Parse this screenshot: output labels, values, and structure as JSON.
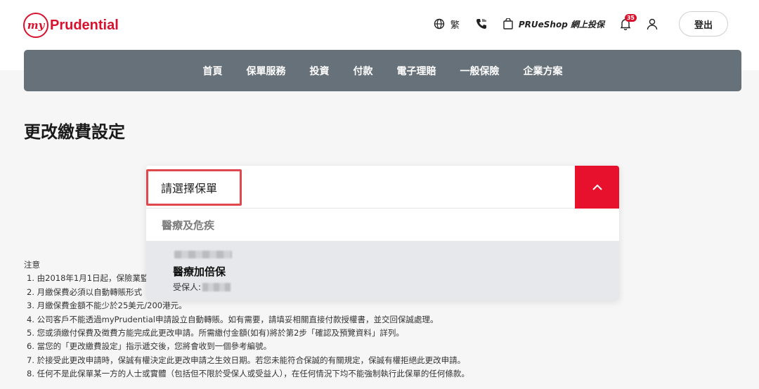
{
  "header": {
    "logo_my": "my",
    "logo_text": "Prudential",
    "language_label": "繁",
    "shop_label": "PRUeShop 網上投保",
    "notification_count": "35",
    "logout_label": "登出"
  },
  "nav": {
    "items": [
      "首頁",
      "保單服務",
      "投資",
      "付款",
      "電子理賠",
      "一般保險",
      "企業方案"
    ]
  },
  "page": {
    "title": "更改繳費設定"
  },
  "dropdown": {
    "placeholder": "請選擇保單",
    "expanded": true,
    "group_label": "醫療及危疾",
    "option": {
      "name": "醫療加倍保",
      "insured_label": "受保人:"
    }
  },
  "notes": {
    "heading": "注意",
    "lines": [
      "1. 由2018年1月1日起，保險業監",
      "2. 月繳保費必須以自動轉賬形式",
      "3. 月繳保費金額不能少於25美元/200港元。",
      "4. 公司客戶不能透過myPrudential申請設立自動轉賬。如有需要，請填妥相關直接付款授權書，並交回保誠處理。",
      "5. 您或須繳付保費及徵費方能完成此更改申請。所需繳付金額(如有)將於第2步「確認及預覽資料」詳列。",
      "6. 當您的「更改繳費設定」指示遞交後，您將會收到一個參考編號。",
      "7. 於接受此更改申請時，保誠有權決定此更改申請之生效日期。若您未能符合保誠的有關規定，保誠有權拒絕此更改申請。",
      "8. 任何不是此保單某一方的人士或實體（包括但不限於受保人或受益人），在任何情況下均不能強制執行此保單的任何條款。"
    ]
  },
  "colors": {
    "brand_red": "#d8122e",
    "nav_bg": "#677179",
    "toggle_red": "#e8112d"
  },
  "icons": [
    "globe-icon",
    "phone-icon",
    "shopping-bag-icon",
    "bell-icon",
    "user-icon",
    "chevron-up-icon"
  ]
}
